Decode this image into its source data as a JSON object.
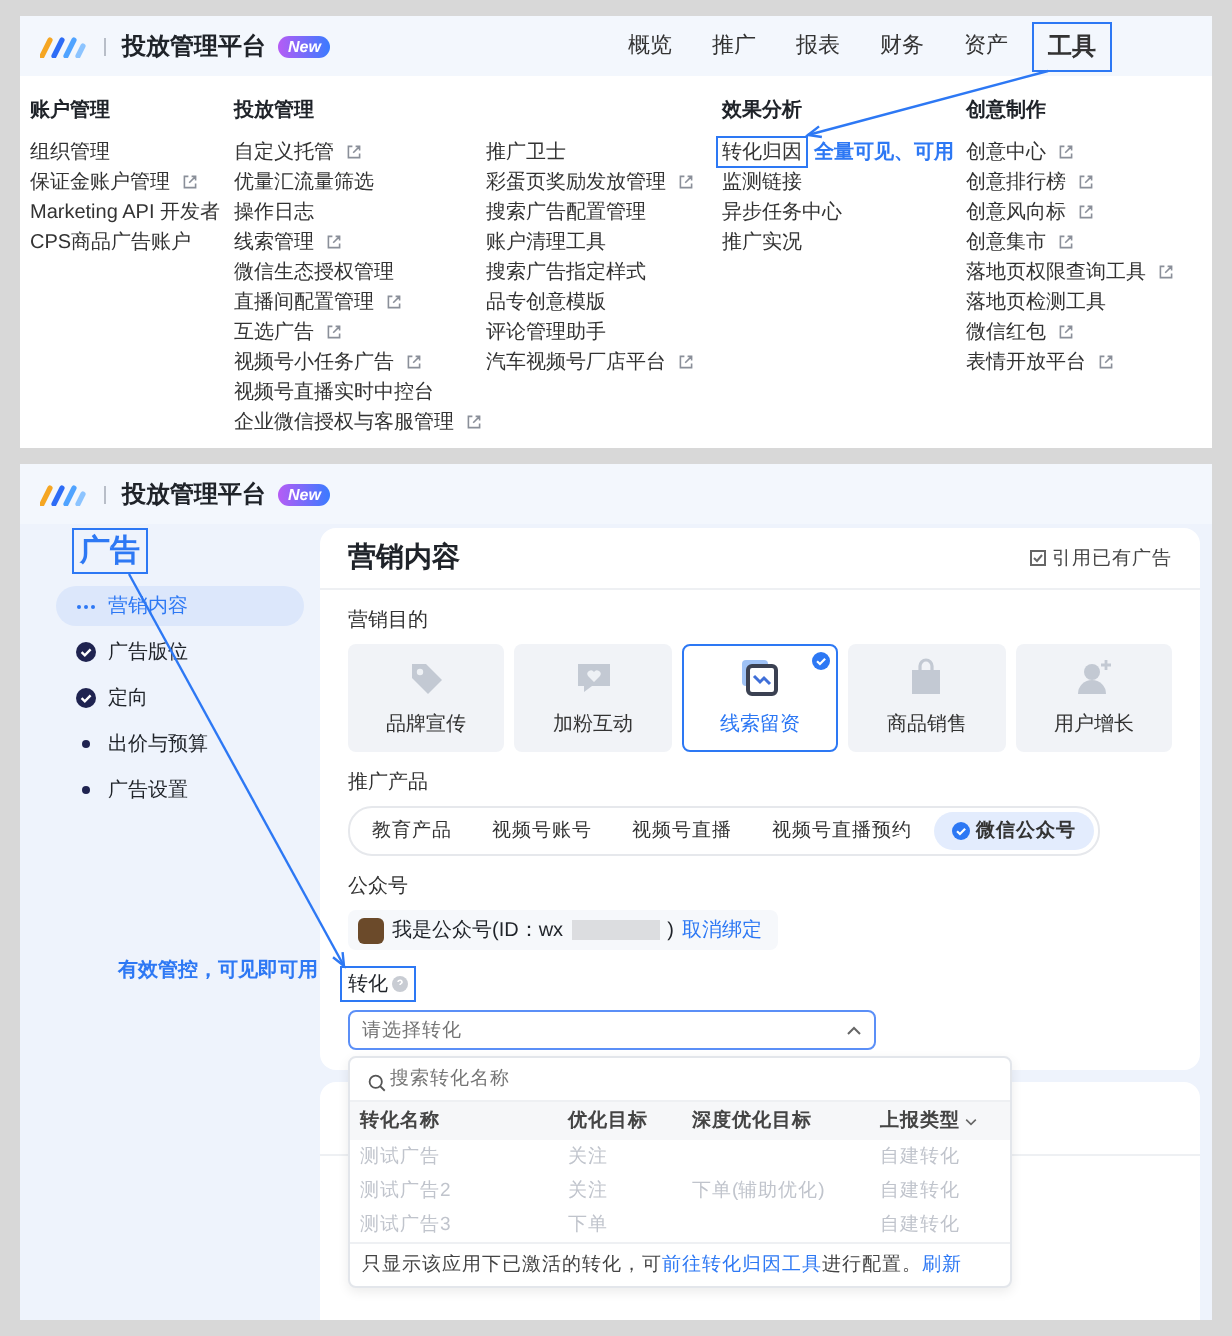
{
  "top_panel": {
    "brand": {
      "title": "投放管理平台",
      "badge": "New"
    },
    "nav": [
      {
        "label": "概览",
        "highlighted": false
      },
      {
        "label": "推广",
        "highlighted": false
      },
      {
        "label": "报表",
        "highlighted": false
      },
      {
        "label": "财务",
        "highlighted": false
      },
      {
        "label": "资产",
        "highlighted": false
      },
      {
        "label": "工具",
        "highlighted": true
      }
    ],
    "menu_columns": [
      {
        "heading": "账户管理",
        "items": [
          {
            "label": "组织管理",
            "external": false,
            "highlighted": false
          },
          {
            "label": "保证金账户管理",
            "external": true,
            "highlighted": false
          },
          {
            "label": "Marketing API 开发者",
            "external": false,
            "highlighted": false
          },
          {
            "label": "CPS商品广告账户",
            "external": false,
            "highlighted": false
          }
        ]
      },
      {
        "heading": "投放管理",
        "items": [
          {
            "label": "自定义托管",
            "external": true,
            "highlighted": false
          },
          {
            "label": "优量汇流量筛选",
            "external": false,
            "highlighted": false
          },
          {
            "label": "操作日志",
            "external": false,
            "highlighted": false
          },
          {
            "label": "线索管理",
            "external": true,
            "highlighted": false
          },
          {
            "label": "微信生态授权管理",
            "external": false,
            "highlighted": false
          },
          {
            "label": "直播间配置管理",
            "external": true,
            "highlighted": false
          },
          {
            "label": "互选广告",
            "external": true,
            "highlighted": false
          },
          {
            "label": "视频号小任务广告",
            "external": true,
            "highlighted": false
          },
          {
            "label": "视频号直播实时中控台",
            "external": false,
            "highlighted": false
          },
          {
            "label": "企业微信授权与客服管理",
            "external": true,
            "highlighted": false
          }
        ]
      },
      {
        "items": [
          {
            "label": "推广卫士",
            "external": false,
            "highlighted": false
          },
          {
            "label": "彩蛋页奖励发放管理",
            "external": true,
            "highlighted": false
          },
          {
            "label": "搜索广告配置管理",
            "external": false,
            "highlighted": false
          },
          {
            "label": "账户清理工具",
            "external": false,
            "highlighted": false
          },
          {
            "label": "搜索广告指定样式",
            "external": false,
            "highlighted": false
          },
          {
            "label": "品专创意模版",
            "external": false,
            "highlighted": false
          },
          {
            "label": "评论管理助手",
            "external": false,
            "highlighted": false
          },
          {
            "label": "汽车视频号厂店平台",
            "external": true,
            "highlighted": false
          }
        ]
      },
      {
        "heading": "效果分析",
        "items": [
          {
            "label": "转化归因",
            "external": false,
            "highlighted": true,
            "note": "全量可见、可用"
          },
          {
            "label": "监测链接",
            "external": false,
            "highlighted": false
          },
          {
            "label": "异步任务中心",
            "external": false,
            "highlighted": false
          },
          {
            "label": "推广实况",
            "external": false,
            "highlighted": false
          }
        ]
      },
      {
        "heading": "创意制作",
        "items": [
          {
            "label": "创意中心",
            "external": true,
            "highlighted": false
          },
          {
            "label": "创意排行榜",
            "external": true,
            "highlighted": false
          },
          {
            "label": "创意风向标",
            "external": true,
            "highlighted": false
          },
          {
            "label": "创意集市",
            "external": true,
            "highlighted": false
          },
          {
            "label": "落地页权限查询工具",
            "external": true,
            "highlighted": false
          },
          {
            "label": "落地页检测工具",
            "external": false,
            "highlighted": false
          },
          {
            "label": "微信红包",
            "external": true,
            "highlighted": false
          },
          {
            "label": "表情开放平台",
            "external": true,
            "highlighted": false
          }
        ]
      }
    ]
  },
  "bottom_panel": {
    "brand": {
      "title": "投放管理平台",
      "badge": "New"
    },
    "sidebar": {
      "title": "广告",
      "highlighted": true,
      "items": [
        {
          "label": "营销内容",
          "kind": "current",
          "selected": true
        },
        {
          "label": "广告版位",
          "kind": "done",
          "selected": false
        },
        {
          "label": "定向",
          "kind": "done",
          "selected": false
        },
        {
          "label": "出价与预算",
          "kind": "todo",
          "selected": false
        },
        {
          "label": "广告设置",
          "kind": "todo",
          "selected": false
        }
      ]
    },
    "card": {
      "title": "营销内容",
      "reference_button": "引用已有广告",
      "goal_label": "营销目的",
      "goals": [
        {
          "label": "品牌宣传",
          "kind": "tag",
          "selected": false
        },
        {
          "label": "加粉互动",
          "kind": "heart",
          "selected": false
        },
        {
          "label": "线索留资",
          "kind": "form",
          "selected": true
        },
        {
          "label": "商品销售",
          "kind": "bag",
          "selected": false
        },
        {
          "label": "用户增长",
          "kind": "user",
          "selected": false
        }
      ],
      "product_label": "推广产品",
      "products": [
        {
          "label": "教育产品",
          "selected": false
        },
        {
          "label": "视频号账号",
          "selected": false
        },
        {
          "label": "视频号直播",
          "selected": false
        },
        {
          "label": "视频号直播预约",
          "selected": false
        },
        {
          "label": "微信公众号",
          "selected": true
        }
      ],
      "account_label": "公众号",
      "account": {
        "name": "我是公众号(ID：wx",
        "name_end": ")",
        "unbind": "取消绑定"
      },
      "conversion": {
        "label": "转化",
        "highlighted": true,
        "note": "有效管控，可见即可用",
        "placeholder": "请选择转化",
        "expanded": true
      },
      "dropdown": {
        "search_placeholder": "搜索转化名称",
        "columns": [
          "转化名称",
          "优化目标",
          "深度优化目标",
          "上报类型"
        ],
        "rows": [
          {
            "cells": [
              "测试广告",
              "关注",
              null,
              "自建转化"
            ],
            "disabled": true
          },
          {
            "cells": [
              "测试广告2",
              "关注",
              "下单(辅助优化)",
              "自建转化"
            ],
            "disabled": true
          },
          {
            "cells": [
              "测试广告3",
              "下单",
              null,
              "自建转化"
            ],
            "disabled": true
          }
        ],
        "footer": {
          "text": "只显示该应用下已激活的转化，可",
          "link": "前往转化归因工具",
          "text_after": "进行配置。",
          "refresh": "刷新"
        }
      }
    }
  }
}
